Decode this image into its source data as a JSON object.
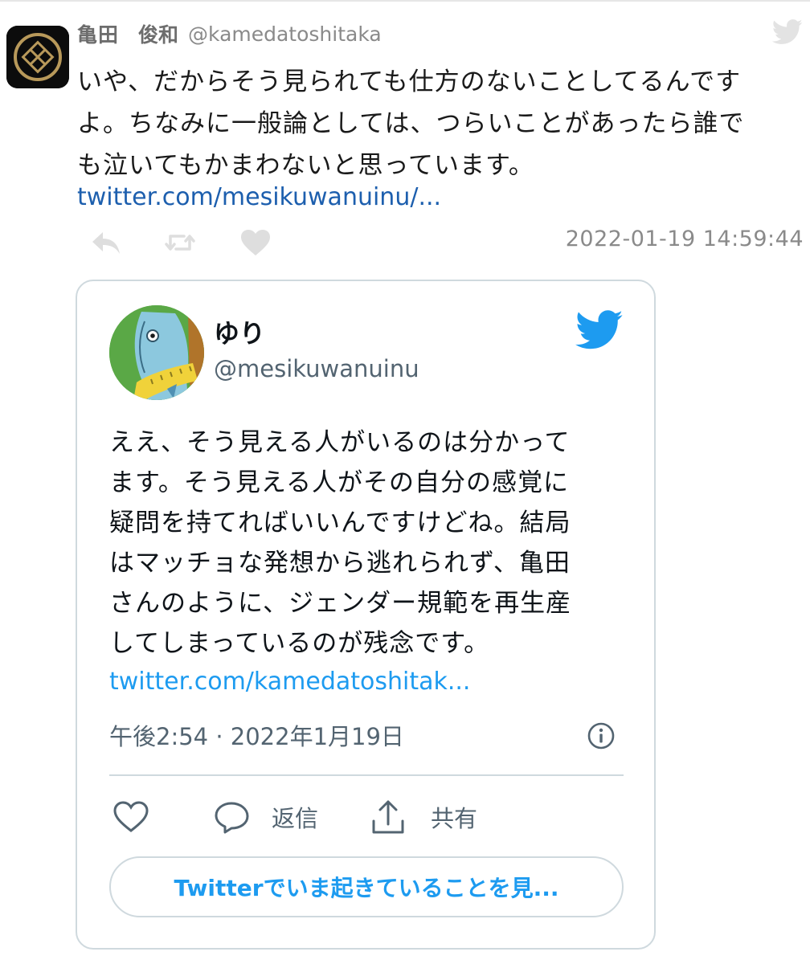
{
  "tweet": {
    "display_name_family": "亀田",
    "display_name_given": "俊和",
    "handle": "@kamedatoshitaka",
    "text_lines": [
      "いや、だからそう見られても仕方のないことしてるんです",
      "よ。ちなみに一般論としては、つらいことがあったら誰で",
      "も泣いてもかまわないと思っています。"
    ],
    "link": "twitter.com/mesikuwanuinu/...",
    "timestamp": "2022-01-19 14:59:44"
  },
  "embed": {
    "name": "ゆり",
    "handle": "@mesikuwanuinu",
    "text_lines": [
      "ええ、そう見える人がいるのは分かって",
      "ます。そう見える人がその自分の感覚に",
      "疑問を持てればいいんですけどね。結局",
      "はマッチョな発想から逃れられず、亀田",
      "さんのように、ジェンダー規範を再生産",
      "してしまっているのが残念です。"
    ],
    "link": "twitter.com/kamedatoshitak...",
    "time": "午後2:54 · 2022年1月19日",
    "reply_label": "返信",
    "share_label": "共有",
    "cta_label": "Twitterでいま起きていることを見..."
  },
  "icons": {
    "corner": "twitter-bird-icon",
    "reply": "reply-icon",
    "retweet": "retweet-icon",
    "like": "heart-icon",
    "info": "info-icon",
    "comment": "speech-bubble-icon",
    "share": "share-icon"
  },
  "colors": {
    "link_main": "#1d5fae",
    "link_embed": "#1d9bf0",
    "twitter_blue": "#1d9bf0",
    "muted": "#8a8a8a",
    "border": "#cfd9de"
  }
}
